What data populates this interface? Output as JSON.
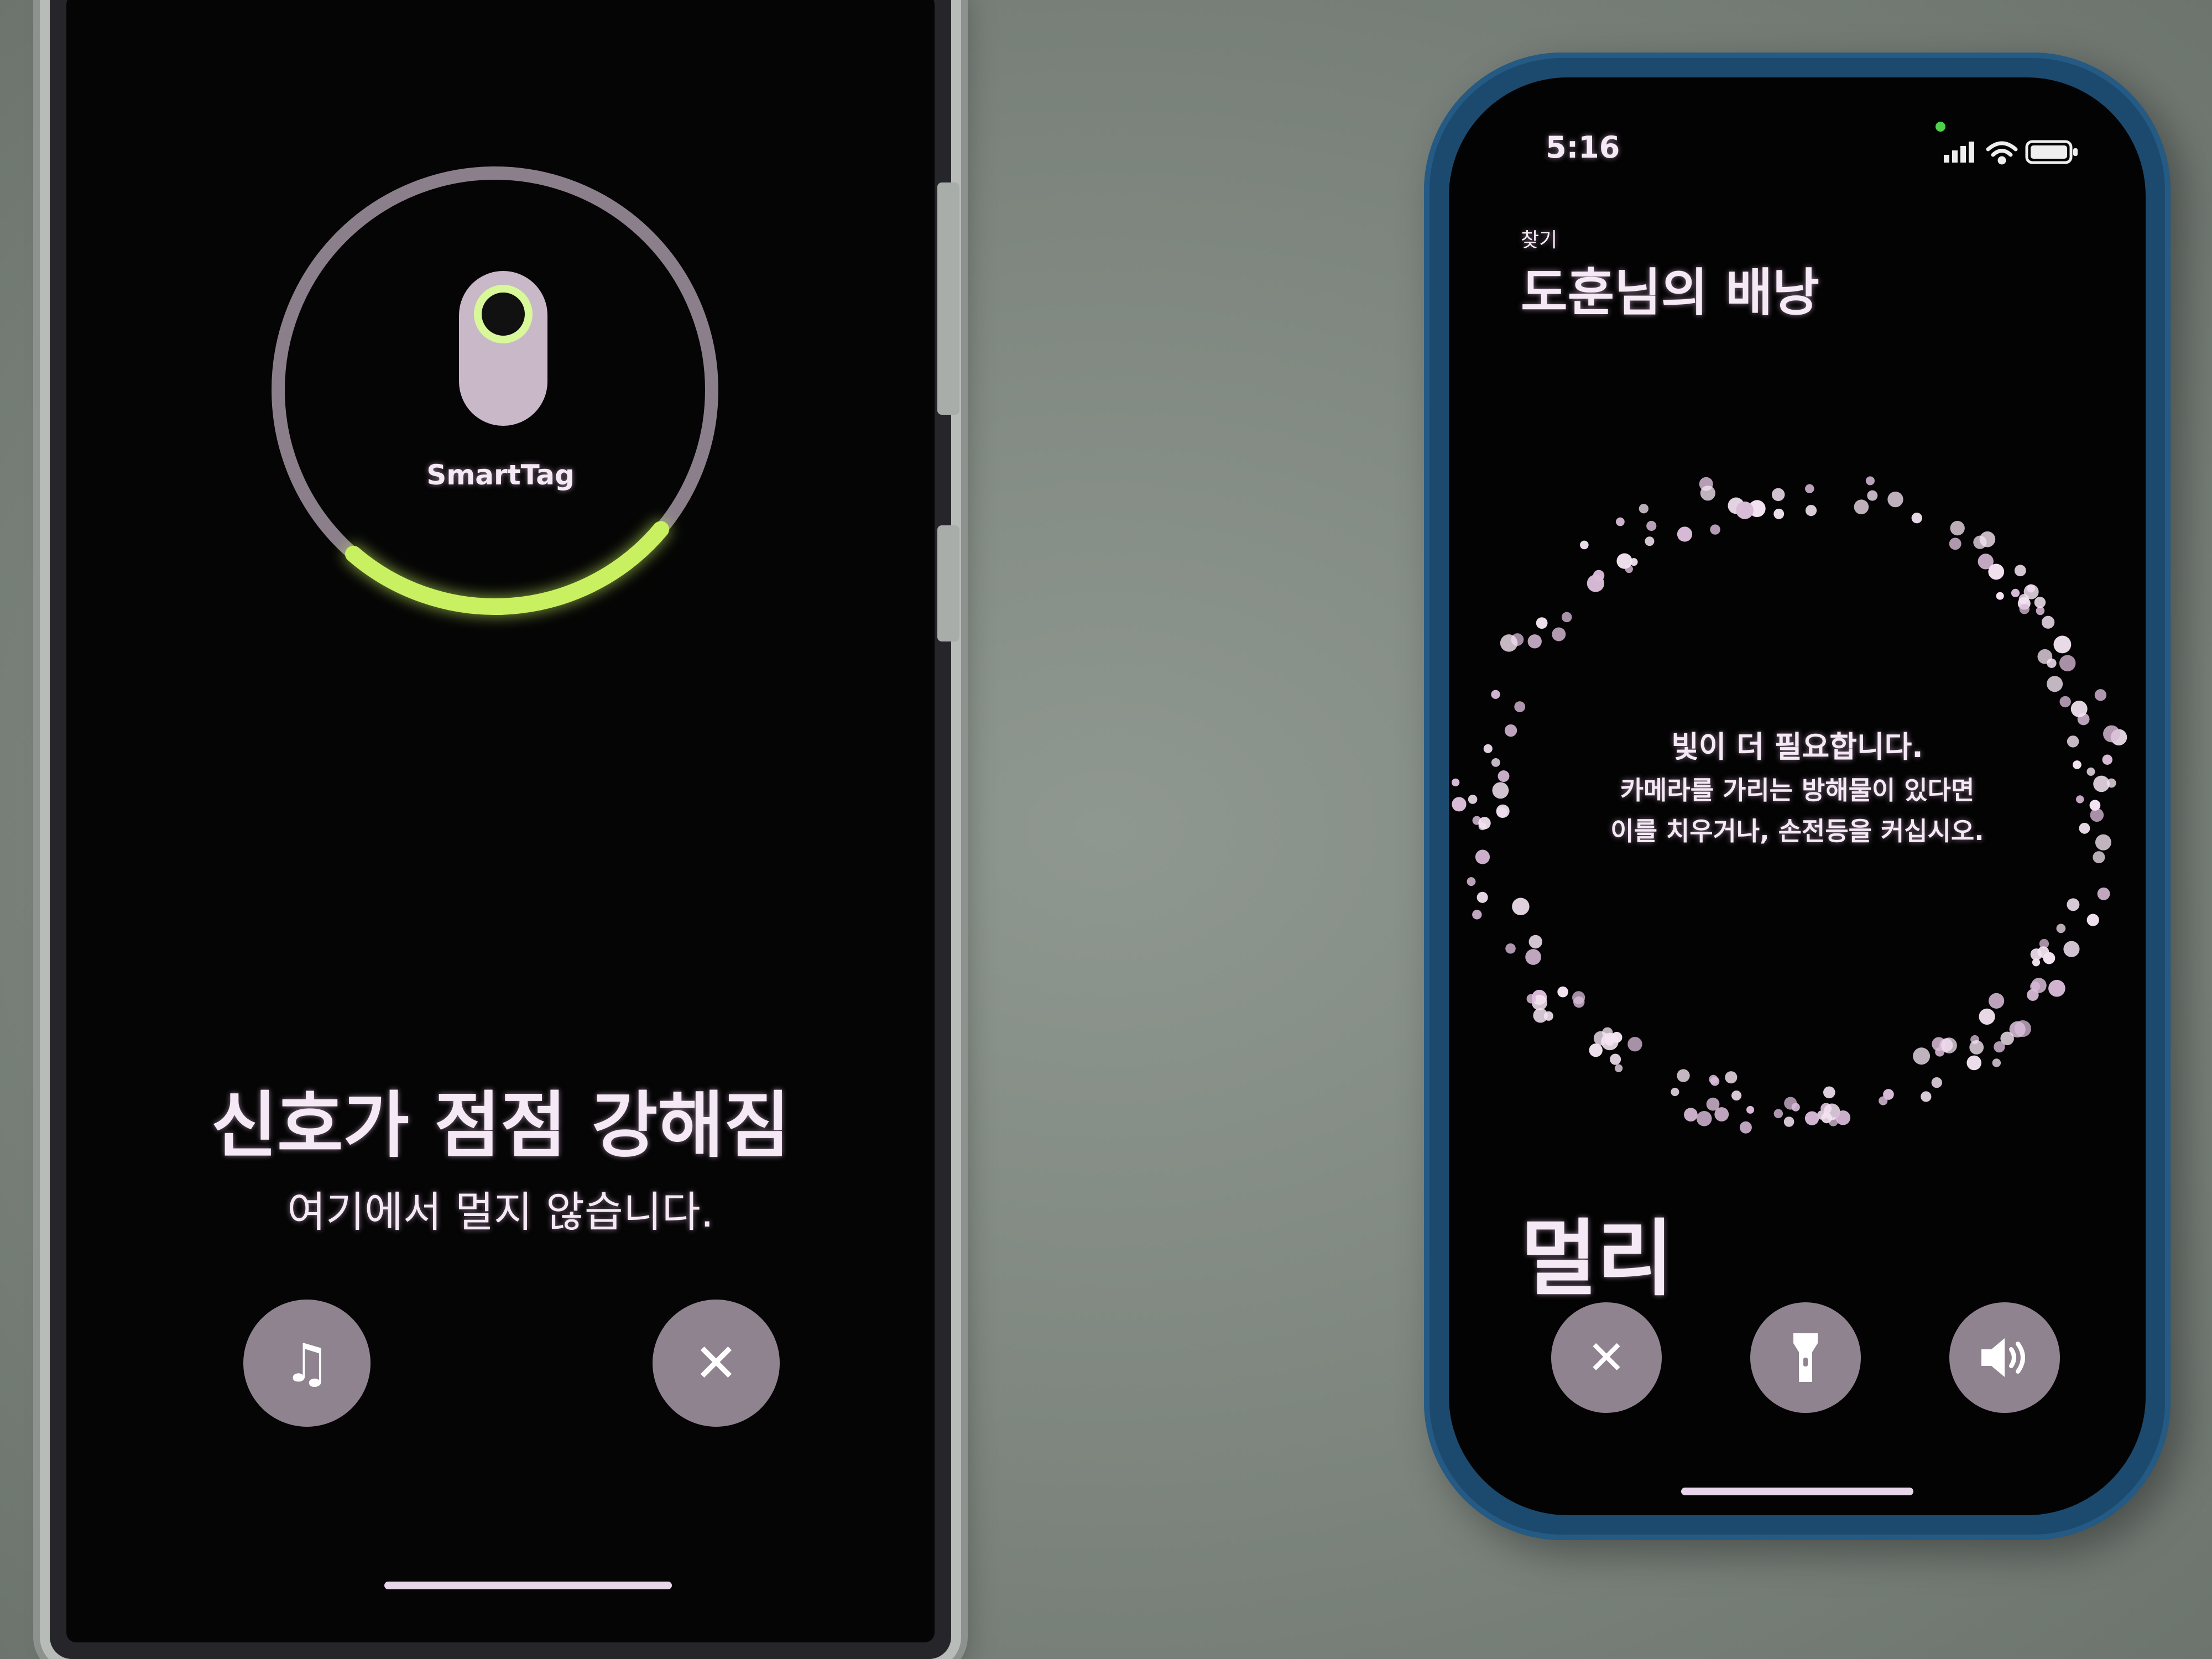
{
  "left_phone": {
    "tag_label": "SmartTag",
    "signal_level": 0.42,
    "title": "신호가 점점 강해짐",
    "subtitle": "여기에서 멀지 않습니다.",
    "sound_icon": "music-note-icon",
    "close_icon": "close-icon",
    "ring_color": "#c8f060"
  },
  "right_phone": {
    "status": {
      "time": "5:16"
    },
    "breadcrumb": "찾기",
    "title": "도훈님의 배낭",
    "message": [
      "빛이 더 필요합니다.",
      "카메라를 가리는 방해물이 있다면",
      "이를 치우거나, 손전등을 커십시오."
    ],
    "distance": "멀리",
    "buttons": [
      "close-icon",
      "flashlight-icon",
      "speaker-icon"
    ]
  }
}
